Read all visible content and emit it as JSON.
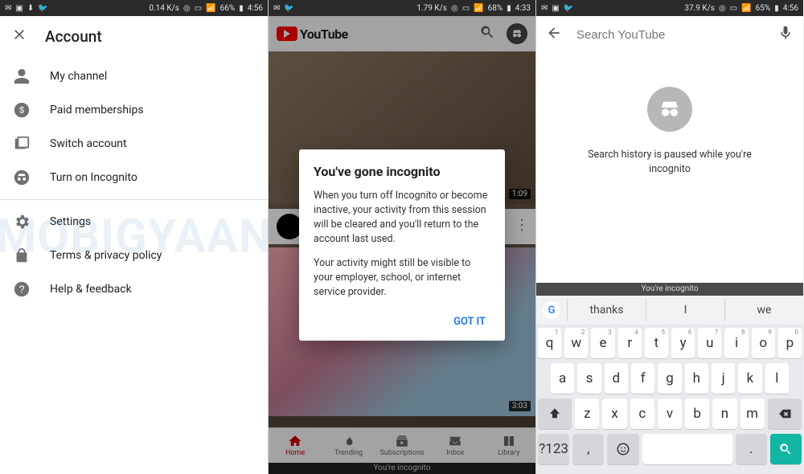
{
  "watermark": "MOBIGYAAN",
  "status": {
    "s1": {
      "speed": "0.14 K/s",
      "battery": "66%",
      "time": "4:56"
    },
    "s2": {
      "speed": "1.79 K/s",
      "battery": "68%",
      "time": "4:33"
    },
    "s3": {
      "speed": "37.9 K/s",
      "battery": "65%",
      "time": "4:56"
    }
  },
  "screen1": {
    "title": "Account",
    "items": {
      "my_channel": "My channel",
      "paid": "Paid memberships",
      "switch": "Switch account",
      "incognito": "Turn on Incognito",
      "settings": "Settings",
      "terms": "Terms & privacy policy",
      "help": "Help & feedback"
    }
  },
  "screen2": {
    "brand": "YouTube",
    "video1_duration": "1:09",
    "video2_duration": "3:03",
    "channel_initial": "",
    "nav": {
      "home": "Home",
      "trending": "Trending",
      "subs": "Subscriptions",
      "inbox": "Inbox",
      "library": "Library"
    },
    "incognito_bar": "You're incognito",
    "dialog": {
      "title": "You've gone incognito",
      "p1": "When you turn off Incognito or become inactive, your activity from this session will be cleared and you'll return to the account last used.",
      "p2": "Your activity might still be visible to your employer, school, or internet service provider.",
      "ok": "GOT IT"
    }
  },
  "screen3": {
    "search_placeholder": "Search YouTube",
    "body_text": "Search history is paused while you're incognito",
    "kbd_header": "You're incognito",
    "suggestions": {
      "a": "thanks",
      "b": "I",
      "c": "we"
    },
    "keys": {
      "row1": [
        "q",
        "w",
        "e",
        "r",
        "t",
        "y",
        "u",
        "i",
        "o",
        "p"
      ],
      "sup1": [
        "1",
        "2",
        "3",
        "4",
        "5",
        "6",
        "7",
        "8",
        "9",
        "0"
      ],
      "row2": [
        "a",
        "s",
        "d",
        "f",
        "g",
        "h",
        "j",
        "k",
        "l"
      ],
      "row3": [
        "z",
        "x",
        "c",
        "v",
        "b",
        "n",
        "m"
      ],
      "sym": "?123",
      "comma": ",",
      "period": "."
    }
  }
}
